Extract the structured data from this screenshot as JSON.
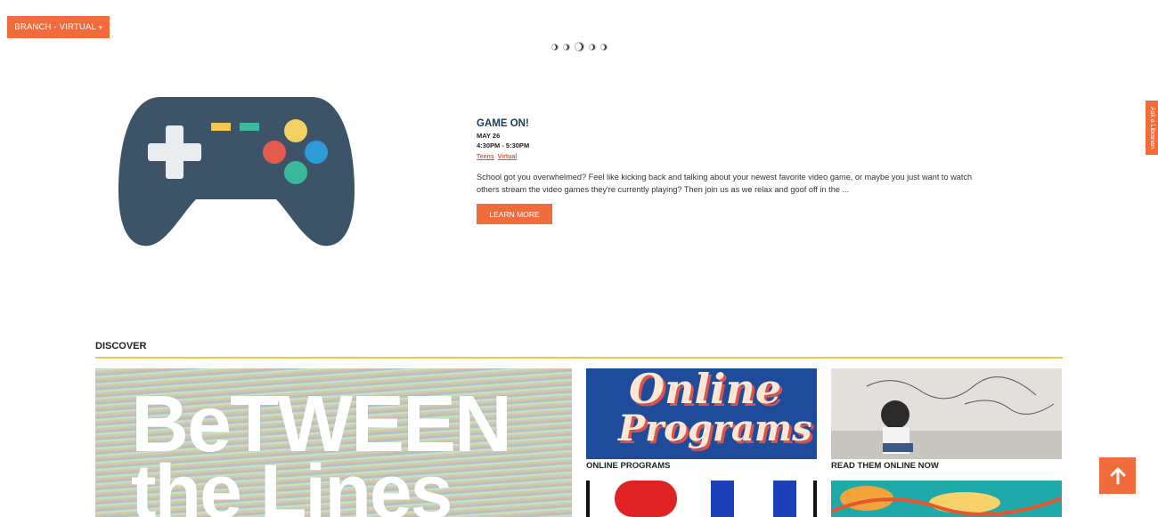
{
  "header": {
    "branch_label": "BRANCH - VIRTUAL",
    "caret": "▾"
  },
  "carousel": {
    "slide_count": 5,
    "active_index": 2
  },
  "event": {
    "title": "GAME ON!",
    "date": "MAY 26",
    "time": "4:30PM - 5:30PM",
    "tags": [
      "Teens",
      "Virtual"
    ],
    "description": "School got you overwhelmed? Feel like kicking back and talking about your newest favorite video game, or maybe you just want to watch others stream the video games they're currently playing? Then join us as we relax and goof off in the ...",
    "cta": "LEARN MORE"
  },
  "side_tab": {
    "label": "Ask a Librarian"
  },
  "discover": {
    "title": "DISCOVER",
    "tiles": [
      {
        "art_line1": "BeTWEEN",
        "art_line2": "the Lines"
      },
      {
        "art_line1": "Online",
        "art_line2": "Programs",
        "caption": "ONLINE PROGRAMS"
      },
      {
        "caption": "READ THEM ONLINE NOW"
      }
    ]
  },
  "colors": {
    "accent": "#f26b3a",
    "title": "#1c3b5a",
    "divider": "#f2c94c"
  },
  "icons": {
    "scroll_top": "arrow-up-icon",
    "hero": "gamepad-icon"
  }
}
